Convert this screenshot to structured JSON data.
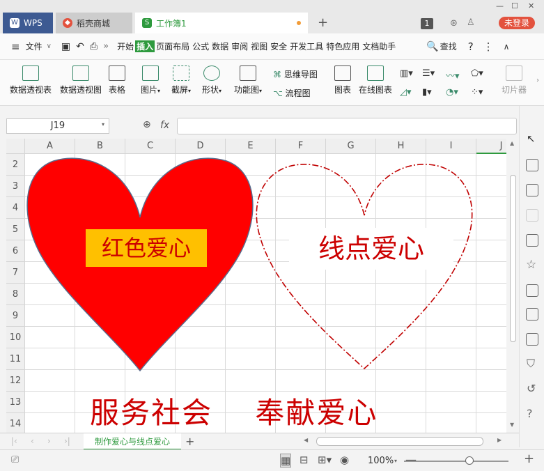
{
  "tabs": {
    "wps": "WPS",
    "daoke": "稻壳商城",
    "workbook": "工作簿1",
    "page_badge": "1",
    "login": "未登录"
  },
  "menu": {
    "file": "文件",
    "items": [
      "开始",
      "插入",
      "页面布局",
      "公式",
      "数据",
      "审阅",
      "视图",
      "安全",
      "开发工具",
      "特色应用",
      "文档助手"
    ],
    "active_item": "插入",
    "search": "查找"
  },
  "toolbar": {
    "pivot_table": "数据透视表",
    "pivot_chart": "数据透视图",
    "table": "表格",
    "picture": "图片",
    "screenshot": "截屏",
    "shape": "形状",
    "function_chart": "功能图",
    "mindmap": "思维导图",
    "flowchart": "流程图",
    "chart": "图表",
    "online_chart": "在线图表",
    "slicer": "切片器"
  },
  "formula": {
    "cell_ref": "J19",
    "fx": "fx",
    "content": ""
  },
  "sheet": {
    "columns": [
      "A",
      "B",
      "C",
      "D",
      "E",
      "F",
      "G",
      "H",
      "I",
      "J"
    ],
    "rows": [
      "2",
      "3",
      "4",
      "5",
      "6",
      "7",
      "8",
      "9",
      "10",
      "11",
      "12",
      "13",
      "14"
    ],
    "textbox_red_heart": "红色爱心",
    "textbox_dotted_heart": "线点爱心",
    "slogan": "服务社会    奉献爱心",
    "heart_fill": "#ff0000",
    "heart_outline": "#c00000",
    "textbox_fill": "#ffc000"
  },
  "sheet_tabs": {
    "active": "制作爱心与线点爱心",
    "add": "+"
  },
  "status": {
    "zoom": "100%"
  }
}
